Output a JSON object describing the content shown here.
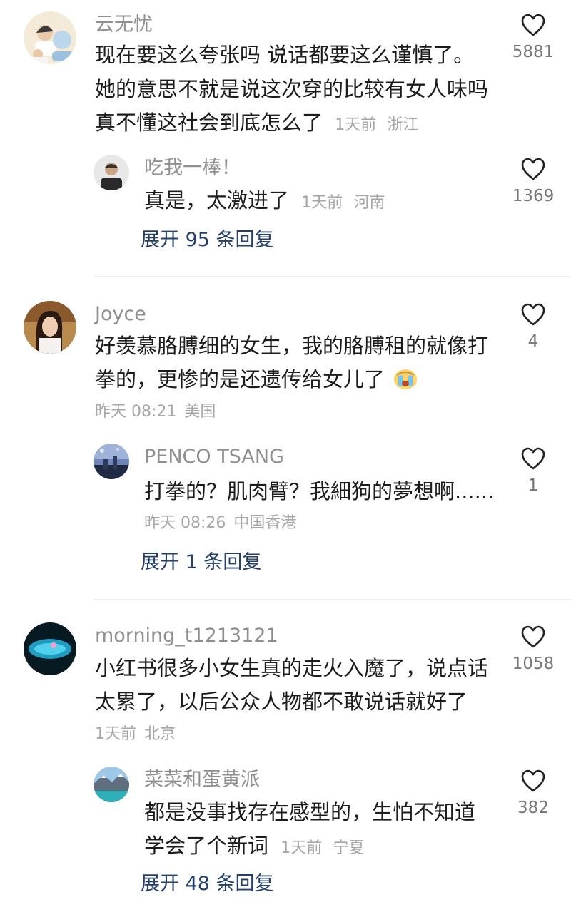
{
  "threads": [
    {
      "user": "云无忧",
      "lines": [
        "现在要这么夸张吗 说话都要这么谨慎了。",
        "她的意思不就是说这次穿的比较有女人味吗",
        "真不懂这社会到底怎么了"
      ],
      "time": "1天前",
      "location": "浙江",
      "likes": "5881",
      "reply": {
        "user": "吃我一棒！",
        "lines": [
          "真是，太激进了"
        ],
        "time": "1天前",
        "location": "河南",
        "likes": "1369"
      },
      "expand": "展开 95 条回复"
    },
    {
      "user": "Joyce",
      "lines": [
        "好羡慕胳膊细的女生，我的胳膊租的就像打",
        "拳的，更惨的是还遗传给女儿了"
      ],
      "time": "昨天 08:21",
      "location": "美国",
      "likes": "4",
      "reply": {
        "user": "PENCO TSANG",
        "lines": [
          "打拳的？肌肉臂？我細狗的夢想啊......"
        ],
        "time": "昨天 08:26",
        "location": "中国香港",
        "likes": "1"
      },
      "expand": "展开 1 条回复"
    },
    {
      "user": "morning_t1213121",
      "lines": [
        "小红书很多小女生真的走火入魔了，说点话",
        "太累了，以后公众人物都不敢说话就好了"
      ],
      "time": "1天前",
      "location": "北京",
      "likes": "1058",
      "reply": {
        "user": "菜菜和蛋黄派",
        "lines": [
          "都是没事找存在感型的，生怕不知道",
          "学会了个新词"
        ],
        "time": "1天前",
        "location": "宁夏",
        "likes": "382"
      },
      "expand": "展开 48 条回复"
    }
  ],
  "icons": {
    "like": "heart-outline-icon",
    "crying_emoji": "crying-emoji-icon"
  },
  "colors": {
    "username": "#8f8f8f",
    "text": "#1c1c1c",
    "meta": "#a6a6a6",
    "expand": "#243f6a",
    "divider": "#f0f0f0"
  }
}
